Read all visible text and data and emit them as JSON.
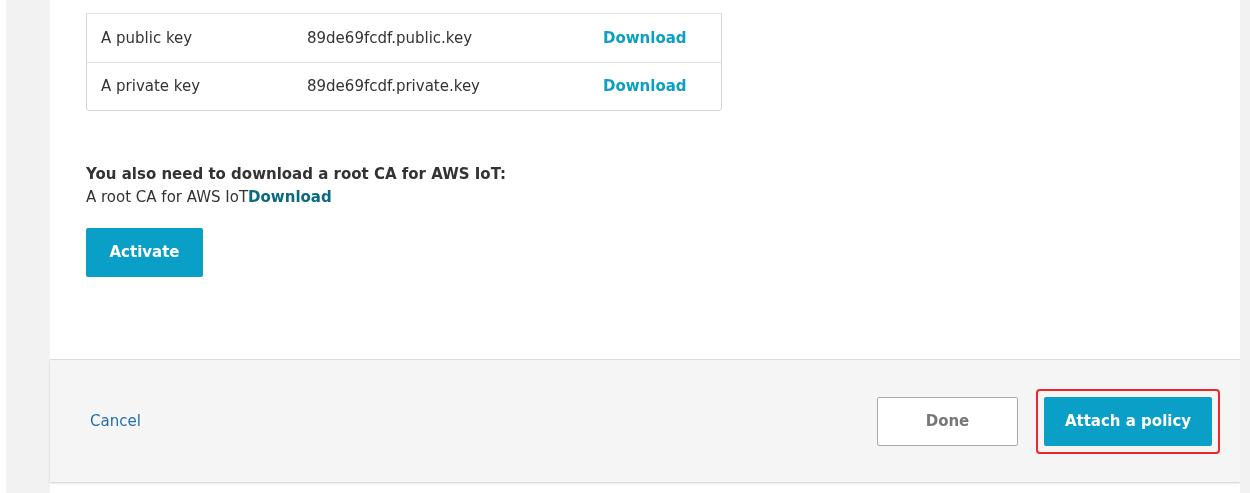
{
  "key_files": [
    {
      "label": "A public key",
      "file": "89de69fcdf.public.key",
      "link": "Download"
    },
    {
      "label": "A private key",
      "file": "89de69fcdf.private.key",
      "link": "Download"
    }
  ],
  "root_ca": {
    "heading": "You also need to download a root CA for AWS IoT:",
    "label": "A root CA for AWS IoT",
    "link": "Download"
  },
  "activate_button": "Activate",
  "footer": {
    "cancel": "Cancel",
    "buttons": [
      {
        "label": "Done",
        "kind": "secondary",
        "highlighted": false
      },
      {
        "label": "Attach a policy",
        "kind": "primary",
        "highlighted": true
      }
    ]
  }
}
